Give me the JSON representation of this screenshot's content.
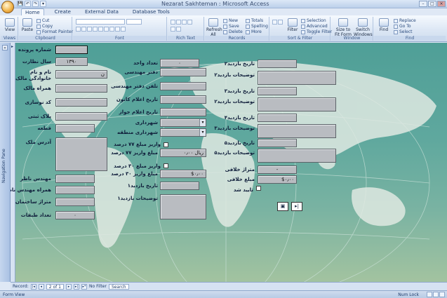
{
  "window": {
    "title": "Nezarat Sakhteman : Microsoft Access",
    "controls": [
      "–",
      "□",
      "×"
    ]
  },
  "quick_access": [
    "💾",
    "↶",
    "↷",
    "▾"
  ],
  "ribbon": {
    "tabs": [
      "Home",
      "Create",
      "External Data",
      "Database Tools"
    ],
    "groups": {
      "views": {
        "label": "Views",
        "view_btn": "View"
      },
      "clipboard": {
        "label": "Clipboard",
        "paste": "Paste",
        "cut": "Cut",
        "copy": "Copy",
        "format_painter": "Format Painter"
      },
      "font": {
        "label": "Font"
      },
      "rich_text": {
        "label": "Rich Text"
      },
      "records": {
        "label": "Records",
        "refresh": "Refresh All",
        "new": "New",
        "save": "Save",
        "delete": "Delete",
        "totals": "Totals",
        "spelling": "Spelling",
        "more": "More"
      },
      "sort_filter": {
        "label": "Sort & Filter",
        "filter": "Filter",
        "selection": "Selection",
        "advanced": "Advanced",
        "toggle_filter": "Toggle Filter"
      },
      "window": {
        "label": "Window",
        "size_to_fit": "Size to Fit Form",
        "switch_windows": "Switch Windows"
      },
      "find": {
        "label": "Find",
        "find": "Find",
        "replace": "Replace",
        "goto": "Go To",
        "select": "Select"
      }
    }
  },
  "nav_pane": {
    "label": "Navigation Pane",
    "toggle": "»"
  },
  "form": {
    "col1": {
      "project_no": {
        "label": "شماره پرونده",
        "value": ""
      },
      "year": {
        "label": "سال نظارت",
        "value": "۱۳۹۰"
      },
      "owner_name": {
        "label": "نام و نام خانوادگی مالک",
        "value": "ن"
      },
      "owner_phone": {
        "label": "همراه مالک",
        "value": ""
      },
      "postal_code": {
        "label": "کد نوسازی",
        "value": ""
      },
      "plaque": {
        "label": "پلاک ثبتی",
        "value": ""
      },
      "piece": {
        "label": "قطعه",
        "value": ""
      },
      "address": {
        "label": "آدرس ملک",
        "value": ""
      },
      "engineer_name": {
        "label": "مهندس ناظر",
        "value": ""
      },
      "engineer_phone": {
        "label": "همراه مهندس ناظر",
        "value": ""
      },
      "building_area": {
        "label": "متراژ ساختمان",
        "value": ""
      },
      "floors": {
        "label": "تعداد طبقات",
        "value": "۰"
      }
    },
    "col2": {
      "unit_count": {
        "label": "تعداد واحد",
        "value": "۰"
      },
      "engineer_office": {
        "label": "دفتر مهندسی",
        "value": ""
      },
      "office_phone": {
        "label": "تلفن دفتر مهندسی",
        "value": ""
      },
      "license_date": {
        "label": "تاریخ اعلام کانون",
        "value": ""
      },
      "permit_date": {
        "label": "تاریخ اعلام جواز",
        "value": ""
      },
      "municipality": {
        "label": "شهرداری",
        "value": ""
      },
      "municipality_region": {
        "label": "شهرداری منطقه",
        "value": ""
      },
      "paid_77": {
        "label": "واریز مبلغ ۷۷ درصد",
        "value": ""
      },
      "amount_77": {
        "label": "مبلغ واریز ۷۷ درصد",
        "value": "ریال ۰٫۰۰"
      },
      "paid_30": {
        "label": "واریز مبلغ ۳۰ درصد",
        "value": ""
      },
      "amount_30": {
        "label": "مبلغ واریز ۳۰ درصد",
        "value": "$۰٫۰۰"
      },
      "visit1_date": {
        "label": "تاریخ بازدید۱",
        "value": ""
      },
      "visit1_desc": {
        "label": "توضیحات بازدید۱",
        "value": ""
      }
    },
    "col3": {
      "visit2_date": {
        "label": "تاریخ بازدید۲",
        "value": ""
      },
      "visit2_desc": {
        "label": "توضیحات بازدید۲",
        "value": ""
      },
      "visit3_date": {
        "label": "تاریخ بازدید۳",
        "value": ""
      },
      "visit3b_desc": {
        "label": "توضیحات بازدید۲",
        "value": ""
      },
      "visit4_date": {
        "label": "تاریخ بازدید۴",
        "value": ""
      },
      "visit3c_desc": {
        "label": "توضیحات بازدید۳",
        "value": ""
      },
      "visit5_date": {
        "label": "تاریخ بازدید۵",
        "value": ""
      },
      "visit5_desc": {
        "label": "توضیحات بازدید۵",
        "value": ""
      },
      "violation_area": {
        "label": "متراژ خلافی",
        "value": "-"
      },
      "violation_amount": {
        "label": "مبلغ خلافی",
        "value": "$۰٫۰۰"
      },
      "confirmed": {
        "label": "تایید شد",
        "value": ""
      }
    },
    "buttons": {
      "print": "▣",
      "next": "▸|"
    }
  },
  "record_nav": {
    "label": "Record:",
    "first": "|◂",
    "prev": "◂",
    "position": "2 of 1",
    "next": "▸",
    "last": "▸|",
    "new": "▸*",
    "filter": "No Filter",
    "search": "Search"
  },
  "status": {
    "left": "Form View",
    "right": "Num Lock"
  }
}
